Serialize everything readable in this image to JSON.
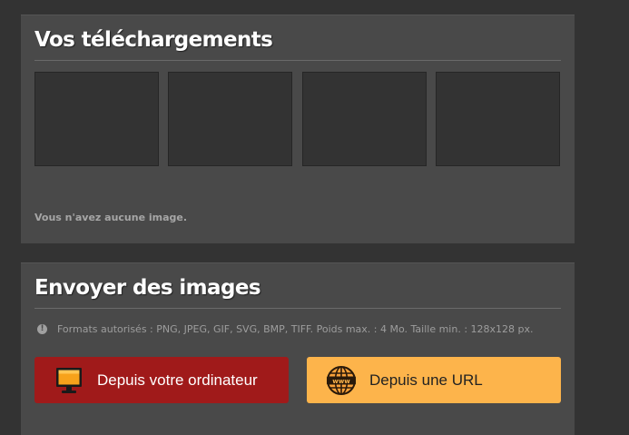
{
  "uploads": {
    "title": "Vos téléchargements",
    "empty_message": "Vous n'avez aucune image."
  },
  "send": {
    "title": "Envoyer des images",
    "formats_info": "Formats autorisés : PNG, JPEG, GIF, SVG, BMP, TIFF. Poids max. : 4 Mo. Taille min. : 128x128 px.",
    "info_icon_glyph": "!",
    "btn_computer_label": "Depuis votre ordinateur",
    "btn_url_label": "Depuis une URL",
    "btn_computer_icon": "computer-monitor-icon",
    "btn_url_icon": "www-globe-icon"
  },
  "colors": {
    "background": "#333333",
    "panel": "#494949",
    "btn_computer": "#a01a1a",
    "btn_url": "#fdb44b"
  }
}
